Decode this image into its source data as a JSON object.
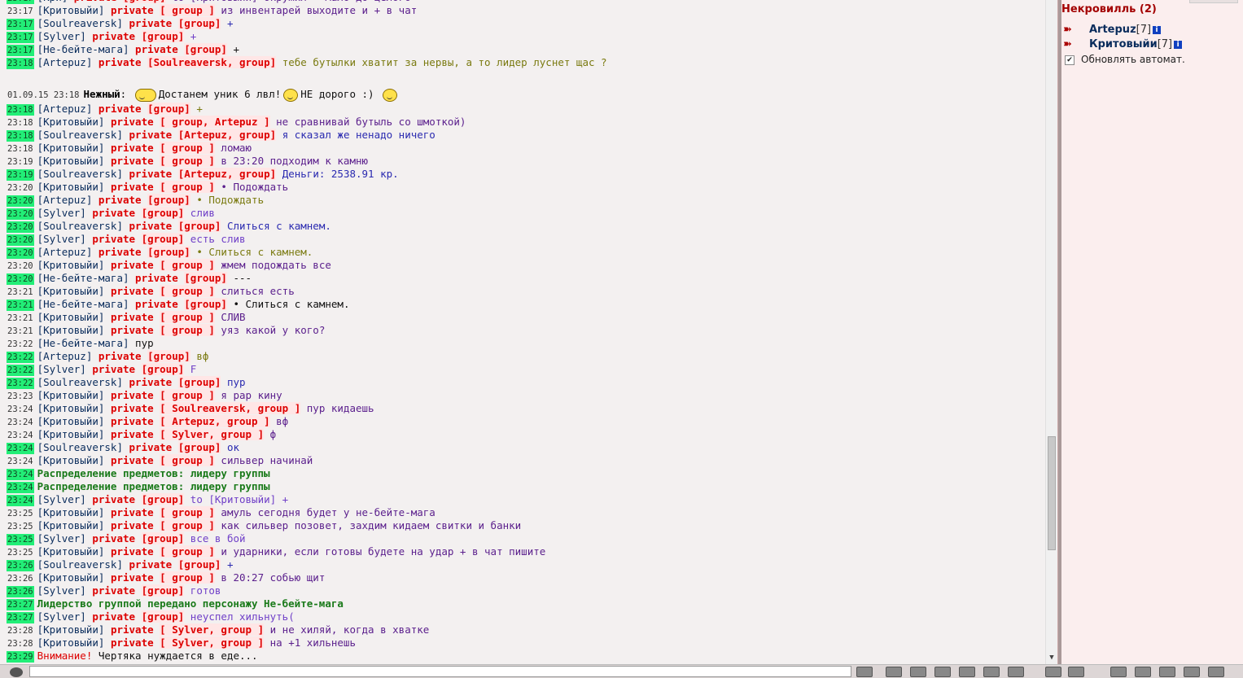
{
  "chat": {
    "lines": [
      {
        "ts": "23:17",
        "hl": true,
        "nick": "Кри",
        "priv": "private",
        "recip": "[group]",
        "rc": "",
        "msg": "to [Критовыйи] окружил - мало до целого",
        "mc": "c-purple"
      },
      {
        "ts": "23:17",
        "hl": false,
        "nick": "Критовыйи",
        "priv": "private",
        "recip": "[ group ]",
        "msg": "из инвентарей выходите и + в чат",
        "mc": "c-purple"
      },
      {
        "ts": "23:17",
        "hl": true,
        "nick": "Soulreaversk",
        "priv": "private",
        "recip": "[group]",
        "msg": "+",
        "mc": "c-blue"
      },
      {
        "ts": "23:17",
        "hl": true,
        "nick": "Sylver",
        "priv": "private",
        "recip": "[group]",
        "msg": "+",
        "mc": "c-lilac"
      },
      {
        "ts": "23:17",
        "hl": true,
        "nick": "Не-бейте-мага",
        "priv": "private",
        "recip": "[group]",
        "msg": "+",
        "mc": "c-black"
      },
      {
        "ts": "23:18",
        "hl": true,
        "nick": "Artepuz",
        "priv": "private",
        "recip": "[Soulreaversk, group]",
        "msg": "тебе бутылки хватит за нервы, а то лидер луснет щас ?",
        "mc": "c-olive"
      },
      {
        "special": "gap"
      },
      {
        "special": "announce",
        "ts": "01.09.15 23:18",
        "nick": "Нежный",
        "msg1": "Достанем уник 6 лвл!",
        "msg2": "НЕ дорого :)"
      },
      {
        "ts": "23:18",
        "hl": true,
        "nick": "Artepuz",
        "priv": "private",
        "recip": "[group]",
        "msg": "+",
        "mc": "c-olive"
      },
      {
        "ts": "23:18",
        "hl": false,
        "nick": "Критовыйи",
        "priv": "private",
        "recip": "[ group, Artepuz ]",
        "msg": "не сравнивай бутыль со шмоткой)",
        "mc": "c-purple"
      },
      {
        "ts": "23:18",
        "hl": true,
        "nick": "Soulreaversk",
        "priv": "private",
        "recip": "[Artepuz, group]",
        "msg": "я сказал же ненадо ничего",
        "mc": "c-blue"
      },
      {
        "ts": "23:18",
        "hl": false,
        "nick": "Критовыйи",
        "priv": "private",
        "recip": "[ group ]",
        "msg": "ломаю",
        "mc": "c-purple"
      },
      {
        "ts": "23:19",
        "hl": false,
        "nick": "Критовыйи",
        "priv": "private",
        "recip": "[ group ]",
        "msg": "в 23:20 подходим к камню",
        "mc": "c-purple"
      },
      {
        "ts": "23:19",
        "hl": true,
        "nick": "Soulreaversk",
        "priv": "private",
        "recip": "[Artepuz, group]",
        "msg": "Деньги: 2538.91 кр.",
        "mc": "c-blue"
      },
      {
        "ts": "23:20",
        "hl": false,
        "nick": "Критовыйи",
        "priv": "private",
        "recip": "[ group ]",
        "msg": "• Подождать",
        "mc": "c-purple"
      },
      {
        "ts": "23:20",
        "hl": true,
        "nick": "Artepuz",
        "priv": "private",
        "recip": "[group]",
        "msg": "• Подождать",
        "mc": "c-olive"
      },
      {
        "ts": "23:20",
        "hl": true,
        "nick": "Sylver",
        "priv": "private",
        "recip": "[group]",
        "msg": "слив",
        "mc": "c-lilac"
      },
      {
        "ts": "23:20",
        "hl": true,
        "nick": "Soulreaversk",
        "priv": "private",
        "recip": "[group]",
        "msg": "Слиться с камнем.",
        "mc": "c-blue"
      },
      {
        "ts": "23:20",
        "hl": true,
        "nick": "Sylver",
        "priv": "private",
        "recip": "[group]",
        "msg": "есть слив",
        "mc": "c-lilac"
      },
      {
        "ts": "23:20",
        "hl": true,
        "nick": "Artepuz",
        "priv": "private",
        "recip": "[group]",
        "msg": "• Слиться с камнем.",
        "mc": "c-olive"
      },
      {
        "ts": "23:20",
        "hl": false,
        "nick": "Критовыйи",
        "priv": "private",
        "recip": "[ group ]",
        "msg": "жмем подождать все",
        "mc": "c-purple"
      },
      {
        "ts": "23:20",
        "hl": true,
        "nick": "Не-бейте-мага",
        "priv": "private",
        "recip": "[group]",
        "msg": "---",
        "mc": "c-black"
      },
      {
        "ts": "23:21",
        "hl": false,
        "nick": "Критовыйи",
        "priv": "private",
        "recip": "[ group ]",
        "msg": "слиться есть",
        "mc": "c-purple"
      },
      {
        "ts": "23:21",
        "hl": true,
        "nick": "Не-бейте-мага",
        "priv": "private",
        "recip": "[group]",
        "msg": "• Слиться с камнем.",
        "mc": "c-black"
      },
      {
        "ts": "23:21",
        "hl": false,
        "nick": "Критовыйи",
        "priv": "private",
        "recip": "[ group ]",
        "msg": "СЛИВ",
        "mc": "c-purple"
      },
      {
        "ts": "23:21",
        "hl": false,
        "nick": "Критовыйи",
        "priv": "private",
        "recip": "[ group ]",
        "msg": "уяз какой у кого?",
        "mc": "c-purple"
      },
      {
        "ts": "23:22",
        "hl": false,
        "nick": "Не-бейте-мага",
        "priv": "",
        "recip": "",
        "msg": "пур",
        "mc": "c-black"
      },
      {
        "ts": "23:22",
        "hl": true,
        "nick": "Artepuz",
        "priv": "private",
        "recip": "[group]",
        "msg": "вф",
        "mc": "c-olive"
      },
      {
        "ts": "23:22",
        "hl": true,
        "nick": "Sylver",
        "priv": "private",
        "recip": "[group]",
        "msg": "F",
        "mc": "c-lilac"
      },
      {
        "ts": "23:22",
        "hl": true,
        "nick": "Soulreaversk",
        "priv": "private",
        "recip": "[group]",
        "msg": "пур",
        "mc": "c-blue"
      },
      {
        "ts": "23:23",
        "hl": false,
        "nick": "Критовыйи",
        "priv": "private",
        "recip": "[ group ]",
        "msg": "я рар кину",
        "mc": "c-purple"
      },
      {
        "ts": "23:24",
        "hl": false,
        "nick": "Критовыйи",
        "priv": "private",
        "recip": "[ Soulreaversk, group ]",
        "msg": "пур кидаешь",
        "mc": "c-purple"
      },
      {
        "ts": "23:24",
        "hl": false,
        "nick": "Критовыйи",
        "priv": "private",
        "recip": "[ Artepuz, group ]",
        "msg": "вф",
        "mc": "c-purple"
      },
      {
        "ts": "23:24",
        "hl": false,
        "nick": "Критовыйи",
        "priv": "private",
        "recip": "[ Sylver, group ]",
        "msg": "ф",
        "mc": "c-purple"
      },
      {
        "ts": "23:24",
        "hl": true,
        "nick": "Soulreaversk",
        "priv": "private",
        "recip": "[group]",
        "msg": "ок",
        "mc": "c-blue"
      },
      {
        "ts": "23:24",
        "hl": false,
        "nick": "Критовыйи",
        "priv": "private",
        "recip": "[ group ]",
        "msg": "сильвер начинай",
        "mc": "c-purple"
      },
      {
        "ts": "23:24",
        "hl": true,
        "special": "system",
        "msg": "Распределение предметов: лидеру группы"
      },
      {
        "ts": "23:24",
        "hl": true,
        "special": "system",
        "msg": "Распределение предметов: лидеру группы"
      },
      {
        "ts": "23:24",
        "hl": true,
        "nick": "Sylver",
        "priv": "private",
        "recip": "[group]",
        "msg": "to [Критовыйи] +",
        "mc": "c-lilac"
      },
      {
        "ts": "23:25",
        "hl": false,
        "nick": "Критовыйи",
        "priv": "private",
        "recip": "[ group ]",
        "msg": "амуль сегодня будет у не-бейте-мага",
        "mc": "c-purple"
      },
      {
        "ts": "23:25",
        "hl": false,
        "nick": "Критовыйи",
        "priv": "private",
        "recip": "[ group ]",
        "msg": "как сильвер позовет, захдим кидаем свитки и банки",
        "mc": "c-purple"
      },
      {
        "ts": "23:25",
        "hl": true,
        "nick": "Sylver",
        "priv": "private",
        "recip": "[group]",
        "msg": "все в бой",
        "mc": "c-lilac"
      },
      {
        "ts": "23:25",
        "hl": false,
        "nick": "Критовыйи",
        "priv": "private",
        "recip": "[ group ]",
        "msg": "и ударники, если готовы будете на удар + в чат пишите",
        "mc": "c-purple"
      },
      {
        "ts": "23:26",
        "hl": true,
        "nick": "Soulreaversk",
        "priv": "private",
        "recip": "[group]",
        "msg": "+",
        "mc": "c-blue"
      },
      {
        "ts": "23:26",
        "hl": false,
        "nick": "Критовыйи",
        "priv": "private",
        "recip": "[ group ]",
        "msg": "в 20:27 собью щит",
        "mc": "c-purple"
      },
      {
        "ts": "23:26",
        "hl": true,
        "nick": "Sylver",
        "priv": "private",
        "recip": "[group]",
        "msg": "готов",
        "mc": "c-lilac"
      },
      {
        "ts": "23:27",
        "hl": true,
        "special": "system",
        "msg": "Лидерство группой передано персонажу Не-бейте-мага"
      },
      {
        "ts": "23:27",
        "hl": true,
        "nick": "Sylver",
        "priv": "private",
        "recip": "[group]",
        "msg": "неуспел хильнуть(",
        "mc": "c-lilac"
      },
      {
        "ts": "23:28",
        "hl": false,
        "nick": "Критовыйи",
        "priv": "private",
        "recip": "[ Sylver, group ]",
        "msg": "и не хиляй, когда в хватке",
        "mc": "c-purple"
      },
      {
        "ts": "23:28",
        "hl": false,
        "nick": "Критовыйи",
        "priv": "private",
        "recip": "[ Sylver, group ]",
        "msg": "на +1 хильнешь",
        "mc": "c-purple"
      },
      {
        "ts": "23:29",
        "hl": true,
        "special": "warning",
        "label": "Внимание!",
        "msg": "Чертяка нуждается в еде..."
      }
    ]
  },
  "panel": {
    "location_title": "Некровилль (2)",
    "members": [
      {
        "name": "Artepuz",
        "level": "[7]"
      },
      {
        "name": "Критовыйи",
        "level": "[7]"
      }
    ],
    "auto_update_label": "Обновлять автомат.",
    "auto_update_checked": "✔"
  },
  "icons": {
    "member_arrow": "arrow-icon",
    "info": "info-icon",
    "scroll_down": "scroll-down-arrow"
  }
}
